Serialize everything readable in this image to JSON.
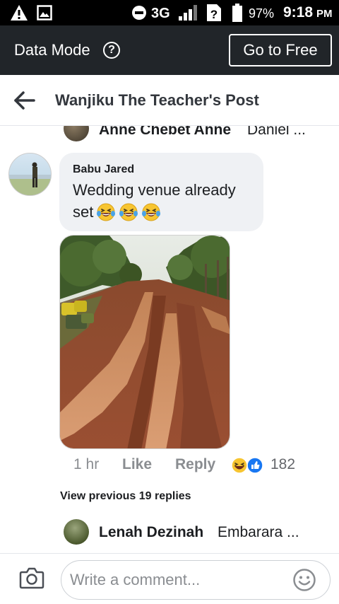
{
  "status_bar": {
    "network": "3G",
    "battery": "97%",
    "time": "9:18",
    "ampm": "PM"
  },
  "data_mode_bar": {
    "label": "Data Mode",
    "info_icon": "info-circle-icon",
    "go_free_label": "Go to Free"
  },
  "header": {
    "back_icon": "back-arrow-icon",
    "title": "Wanjiku The Teacher's Post"
  },
  "cut_reply": {
    "name": "Anne Chebet Anne",
    "text": "Daniel ..."
  },
  "comment": {
    "author": "Babu Jared",
    "line1": "Wedding venue already",
    "line2": "set",
    "emojis": [
      "laughing-tears-icon",
      "laughing-tears-icon",
      "laughing-tears-icon"
    ],
    "time": "1 hr",
    "like_label": "Like",
    "reply_label": "Reply",
    "reaction_icons": [
      "haha-reaction-icon",
      "like-reaction-icon"
    ],
    "reaction_count": "182"
  },
  "view_previous": "View previous 19 replies",
  "reply": {
    "name": "Lenah Dezinah",
    "text": "Embarara ..."
  },
  "composer": {
    "placeholder": "Write a comment...",
    "camera_icon": "camera-icon",
    "emoji_icon": "smiley-icon"
  },
  "colors": {
    "status_bar_bg": "#000000",
    "data_bar_bg": "#212529",
    "bubble_bg": "#eff1f4",
    "muted_text": "#8a8d91",
    "like_blue": "#1877f2"
  }
}
